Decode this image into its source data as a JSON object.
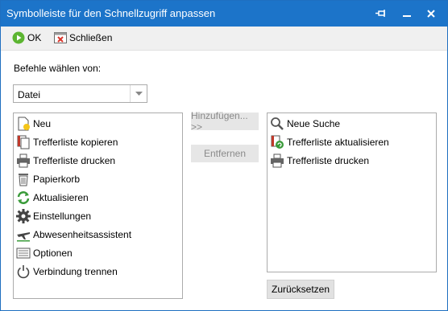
{
  "window": {
    "title": "Symbolleiste für den Schnellzugriff anpassen"
  },
  "toolbar": {
    "ok_label": "OK",
    "close_label": "Schließen"
  },
  "source": {
    "label": "Befehle wählen von:",
    "selected": "Datei"
  },
  "available_commands": [
    {
      "label": "Neu",
      "icon": "new-document-icon"
    },
    {
      "label": "Trefferliste kopieren",
      "icon": "copy-list-icon"
    },
    {
      "label": "Trefferliste drucken",
      "icon": "printer-icon"
    },
    {
      "label": "Papierkorb",
      "icon": "trash-icon"
    },
    {
      "label": "Aktualisieren",
      "icon": "refresh-icon"
    },
    {
      "label": "Einstellungen",
      "icon": "gear-icon"
    },
    {
      "label": "Abwesenheitsassistent",
      "icon": "airplane-icon"
    },
    {
      "label": "Optionen",
      "icon": "options-icon"
    },
    {
      "label": "Verbindung trennen",
      "icon": "power-icon"
    }
  ],
  "actions": {
    "add_label": "Hinzufügen... >>",
    "remove_label": "Entfernen",
    "reset_label": "Zurücksetzen"
  },
  "selected_commands": [
    {
      "label": "Neue Suche",
      "icon": "search-icon"
    },
    {
      "label": "Trefferliste aktualisieren",
      "icon": "refresh-list-icon"
    },
    {
      "label": "Trefferliste drucken",
      "icon": "printer-icon"
    }
  ],
  "colors": {
    "titlebar": "#1c74c9",
    "ok_green": "#5cb531",
    "close_red": "#d9342b"
  }
}
